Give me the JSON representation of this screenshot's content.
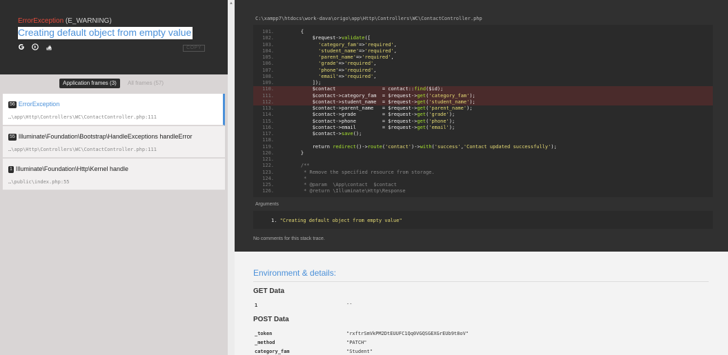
{
  "header": {
    "exception_class": "ErrorException",
    "exception_level": " (E_WARNING)",
    "message": "Creating default object from empty value",
    "copy_label": "COPY"
  },
  "icons": [
    "google-icon",
    "duckduckgo-icon",
    "stackoverflow-icon"
  ],
  "tabs": {
    "application": "Application frames (3)",
    "all": "All frames (57)"
  },
  "frames": [
    {
      "num": "56",
      "title": "ErrorException",
      "path": "…\\app\\Http\\Controllers\\WC\\ContactController.php:111"
    },
    {
      "num": "55",
      "title": "Illuminate\\Foundation\\Bootstrap\\HandleExceptions handleError",
      "path": "…\\app\\Http\\Controllers\\WC\\ContactController.php:111"
    },
    {
      "num": "1",
      "title": "Illuminate\\Foundation\\Http\\Kernel handle",
      "path": "…\\public\\index.php:55"
    }
  ],
  "file_path": "C:\\xampp7\\htdocs\\work-dava\\origo\\app\\Http\\Controllers\\WC\\ContactController.php",
  "code_lines": [
    {
      "n": "101.",
      "code": "    {"
    },
    {
      "n": "102.",
      "code": "        $request->validate(["
    },
    {
      "n": "103.",
      "code": "          'category_fam'=>'required',"
    },
    {
      "n": "104.",
      "code": "          'student_name'=>'required',"
    },
    {
      "n": "105.",
      "code": "          'parent_name'=>'required',"
    },
    {
      "n": "106.",
      "code": "          'grade'=>'required',"
    },
    {
      "n": "107.",
      "code": "          'phone'=>'required',"
    },
    {
      "n": "108.",
      "code": "          'email'=>'required',"
    },
    {
      "n": "109.",
      "code": "        ]);"
    },
    {
      "n": "110.",
      "code": "        $contact                = contact::find($id);"
    },
    {
      "n": "111.",
      "code": "        $contact->category_fam  = $request->get('category_fam');"
    },
    {
      "n": "112.",
      "code": "        $contact->student_name  = $request->get('student_name');"
    },
    {
      "n": "113.",
      "code": "        $contact->parent_name   = $request->get('parent_name');"
    },
    {
      "n": "114.",
      "code": "        $contact->grade         = $request->get('grade');"
    },
    {
      "n": "115.",
      "code": "        $contact->phone         = $request->get('phone');"
    },
    {
      "n": "116.",
      "code": "        $contact->email         = $request->get('email');"
    },
    {
      "n": "117.",
      "code": "        $contact->save();"
    },
    {
      "n": "118.",
      "code": ""
    },
    {
      "n": "119.",
      "code": "        return redirect()->route('contact')->with('success','Contact updated successfully');"
    },
    {
      "n": "120.",
      "code": "    }"
    },
    {
      "n": "121.",
      "code": ""
    },
    {
      "n": "122.",
      "code": "    /**"
    },
    {
      "n": "123.",
      "code": "     * Remove the specified resource from storage."
    },
    {
      "n": "124.",
      "code": "     *"
    },
    {
      "n": "125.",
      "code": "     * @param  \\App\\contact  $contact"
    },
    {
      "n": "126.",
      "code": "     * @return \\Illuminate\\Http\\Response"
    }
  ],
  "highlight_lines": [
    "110.",
    "111.",
    "112."
  ],
  "arguments": {
    "label": "Arguments",
    "items": [
      "1. \"Creating default object from empty value\""
    ]
  },
  "no_comments": "No comments for this stack trace.",
  "env": {
    "title": "Environment & details:",
    "get": {
      "title": "GET Data",
      "rows": [
        {
          "key": "1",
          "value": "--"
        }
      ]
    },
    "post": {
      "title": "POST Data",
      "rows": [
        {
          "key": "_token",
          "value": "\"rxftrSmVkPM2DtEUUFC1Qq0VGQSGEXGrEUb9t8oV\""
        },
        {
          "key": "_method",
          "value": "\"PATCH\""
        },
        {
          "key": "category_fam",
          "value": "\"Student\""
        }
      ]
    }
  },
  "colors": {
    "accent": "#4a90d9",
    "error": "#e74c3c",
    "highlight": "#4a2b2b"
  }
}
